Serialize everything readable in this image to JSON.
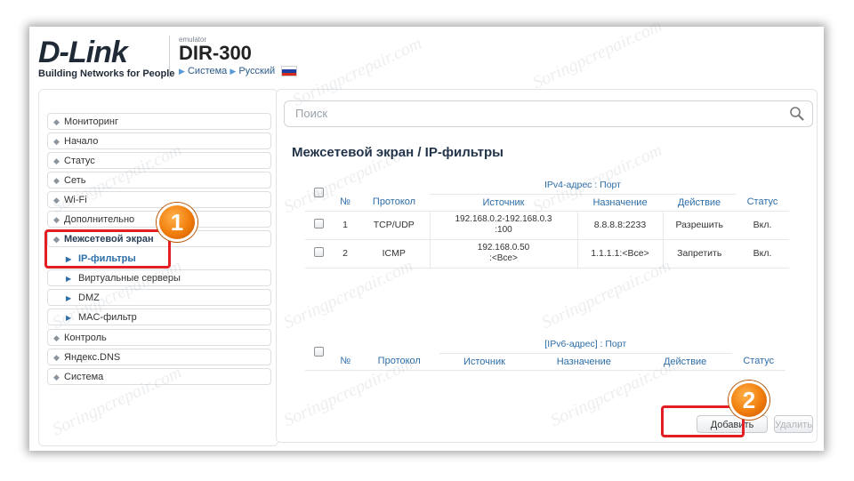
{
  "header": {
    "logo": "D-Link",
    "logo_tagline": "Building Networks for People",
    "emulator_label": "emulator",
    "model": "DIR-300",
    "system_link": "Система",
    "language_link": "Русский",
    "flag_colors": [
      "#ffffff",
      "#1c3fa0",
      "#d52b1e"
    ]
  },
  "sidebar": {
    "items": [
      {
        "label": "Мониторинг"
      },
      {
        "label": "Начало"
      },
      {
        "label": "Статус"
      },
      {
        "label": "Сеть"
      },
      {
        "label": "Wi-Fi"
      },
      {
        "label": "Дополнительно"
      },
      {
        "label": "Межсетевой экран"
      },
      {
        "label": "IP-фильтры"
      },
      {
        "label": "Виртуальные серверы"
      },
      {
        "label": "DMZ"
      },
      {
        "label": "MAC-фильтр"
      },
      {
        "label": "Контроль"
      },
      {
        "label": "Яндекс.DNS"
      },
      {
        "label": "Система"
      }
    ]
  },
  "search": {
    "placeholder": "Поиск"
  },
  "page_title": "Межсетевой экран /  IP-фильтры",
  "ipv4": {
    "group_label": "IPv4-адрес : Порт",
    "columns": [
      "№",
      "Протокол",
      "Источник",
      "Назначение",
      "Действие",
      "Статус"
    ],
    "rows": [
      {
        "num": "1",
        "protocol": "TCP/UDP",
        "source_l1": "192.168.0.2-192.168.0.3",
        "source_l2": ":100",
        "dest": "8.8.8.8:2233",
        "action": "Разрешить",
        "status": "Вкл."
      },
      {
        "num": "2",
        "protocol": "ICMP",
        "source_l1": "192.168.0.50",
        "source_l2": ":<Все>",
        "dest": "1.1.1.1:<Все>",
        "action": "Запретить",
        "status": "Вкл."
      }
    ]
  },
  "ipv6": {
    "group_label": "[IPv6-адрес] : Порт",
    "columns": [
      "№",
      "Протокол",
      "Источник",
      "Назначение",
      "Действие",
      "Статус"
    ]
  },
  "buttons": {
    "add": "Добавить",
    "delete": "Удалить"
  },
  "annotations": {
    "step1": "1",
    "step2": "2"
  },
  "watermark": "Soringpcrepair.com",
  "colors": {
    "accent": "#2d6ea8",
    "highlight": "#e31e24",
    "badge": "#f07d0c"
  }
}
